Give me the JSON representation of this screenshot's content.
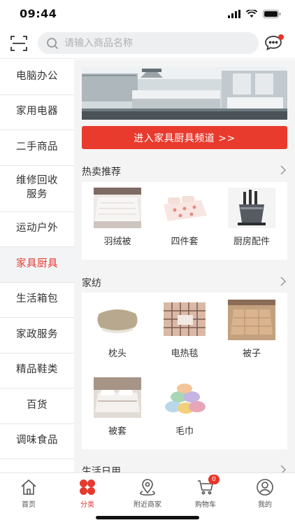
{
  "status_bar": {
    "time": "09:44"
  },
  "header": {
    "search_placeholder": "请输入商品名称"
  },
  "sidebar": {
    "items": [
      {
        "label": "电脑办公"
      },
      {
        "label": "家用电器"
      },
      {
        "label": "二手商品"
      },
      {
        "label": "维修回收\n服务"
      },
      {
        "label": "运动户外"
      },
      {
        "label": "家具厨具"
      },
      {
        "label": "生活箱包"
      },
      {
        "label": "家政服务"
      },
      {
        "label": "精品鞋类"
      },
      {
        "label": "百货"
      },
      {
        "label": "调味食品"
      },
      {
        "label": ""
      }
    ],
    "active_index": 5
  },
  "content": {
    "enter_button": "进入家具厨具频道 >>",
    "sections": [
      {
        "title": "热卖推荐",
        "products": [
          {
            "label": "羽绒被"
          },
          {
            "label": "四件套"
          },
          {
            "label": "厨房配件"
          }
        ]
      },
      {
        "title": "家纺",
        "products": [
          {
            "label": "枕头"
          },
          {
            "label": "电热毯"
          },
          {
            "label": "被子"
          },
          {
            "label": "被套"
          },
          {
            "label": "毛巾"
          }
        ]
      },
      {
        "title": "生活日用"
      }
    ]
  },
  "tabbar": {
    "tabs": [
      {
        "label": "首页",
        "icon": "home-icon"
      },
      {
        "label": "分类",
        "icon": "category-icon"
      },
      {
        "label": "附近商家",
        "icon": "location-icon"
      },
      {
        "label": "购物车",
        "icon": "cart-icon",
        "badge": "0"
      },
      {
        "label": "我的",
        "icon": "profile-icon"
      }
    ],
    "active_index": 1
  },
  "colors": {
    "accent": "#e93a2e",
    "sidebar_active_text": "#e53a2f"
  }
}
